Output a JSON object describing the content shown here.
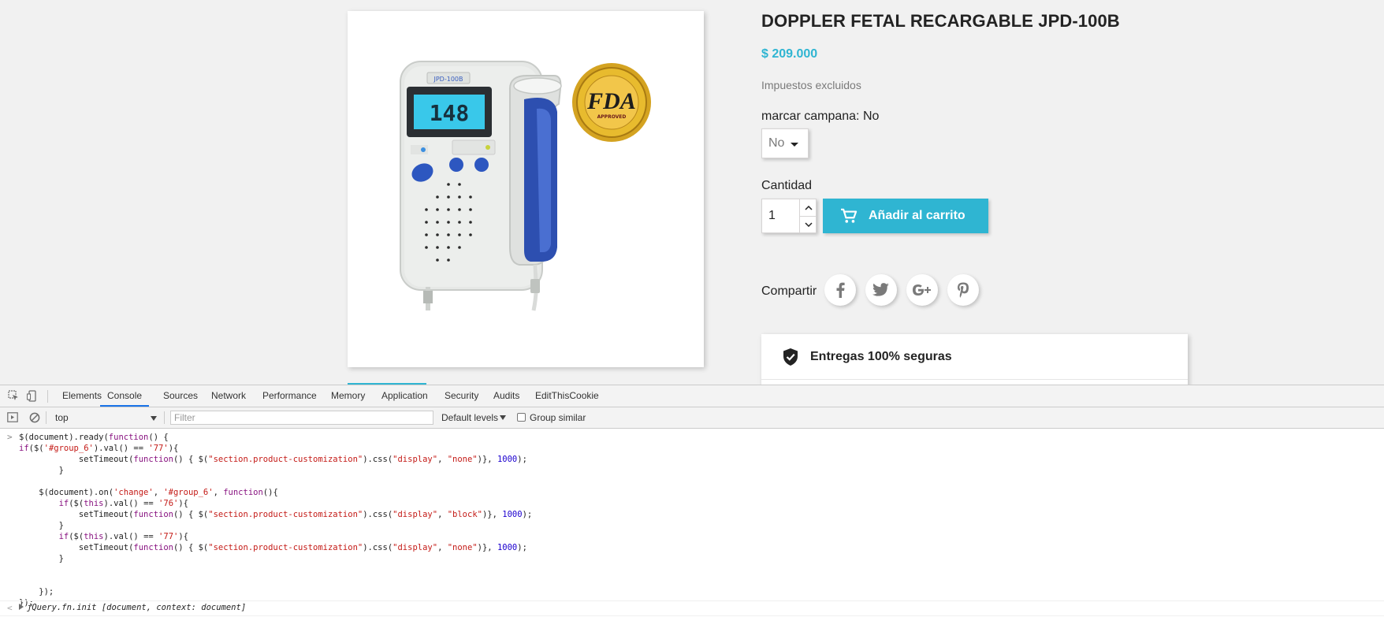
{
  "product": {
    "title": "DOPPLER FETAL RECARGABLE JPD-100B",
    "price": "$ 209.000",
    "tax_note": "Impuestos excluidos",
    "device_model": "JPD-100B",
    "device_reading": "148",
    "fda_seal_text": "FDA",
    "fda_seal_sub": "APPROVED"
  },
  "variant": {
    "label": "marcar campana: No",
    "selected": "No"
  },
  "quantity": {
    "label": "Cantidad",
    "value": "1"
  },
  "cart": {
    "add_label": "Añadir al carrito"
  },
  "share": {
    "label": "Compartir",
    "networks": [
      "facebook",
      "twitter",
      "google-plus",
      "pinterest"
    ]
  },
  "reassurance": {
    "item1": "Entregas 100% seguras"
  },
  "devtools": {
    "tabs": [
      "Elements",
      "Console",
      "Sources",
      "Network",
      "Performance",
      "Memory",
      "Application",
      "Security",
      "Audits",
      "EditThisCookie"
    ],
    "active_tab": "Console",
    "context": "top",
    "filter_placeholder": "Filter",
    "levels": "Default levels",
    "group_similar": "Group similar",
    "output": "jQuery.fn.init [document, context: document]"
  },
  "colors": {
    "accent": "#2fb5d2",
    "text": "#232323",
    "muted": "#7a7a7a",
    "page_bg": "#f1f1f1"
  }
}
